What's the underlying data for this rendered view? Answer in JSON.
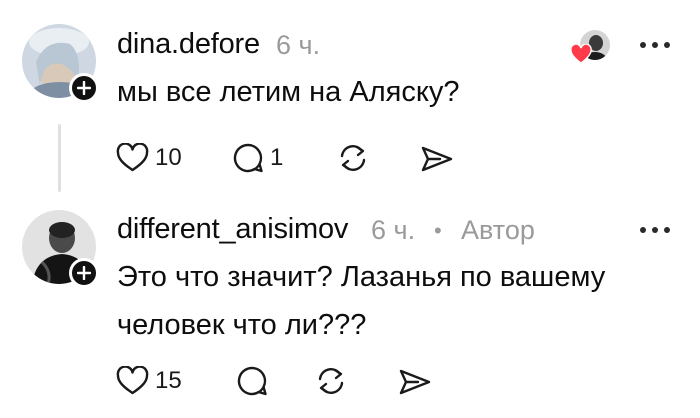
{
  "comments": [
    {
      "username": "dina.defore",
      "time": "6 ч.",
      "text_lines": [
        "мы все летим на Аляску?"
      ],
      "likes": "10",
      "replies": "1"
    },
    {
      "username": "different_anisimov",
      "time": "6 ч.",
      "badge": "Автор",
      "separator": "•",
      "text_lines": [
        "Это что значит? Лазанья по вашему",
        "человек что ли???"
      ],
      "likes": "15"
    }
  ],
  "icons": [
    "heart-icon",
    "comment-icon",
    "repost-icon",
    "share-icon",
    "more-icon",
    "plus-icon"
  ],
  "colors": {
    "liked_heart": "#ff3b4a",
    "muted_text": "#9a9a9a"
  }
}
